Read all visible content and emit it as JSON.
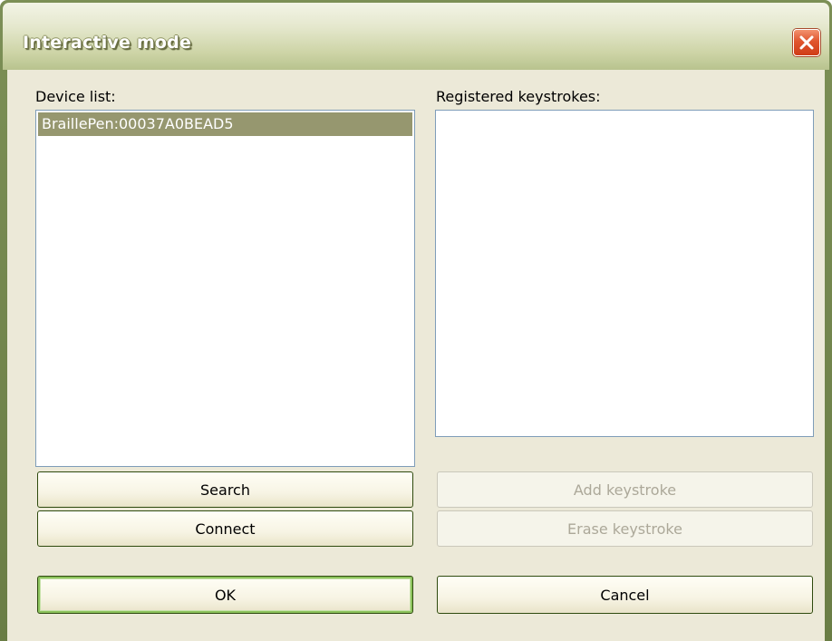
{
  "window": {
    "title": "Interactive mode",
    "close_icon": "close-icon"
  },
  "device_list": {
    "label": "Device list:",
    "items": [
      {
        "text": "BraillePen:00037A0BEAD5",
        "selected": true
      }
    ]
  },
  "keystrokes": {
    "label": "Registered keystrokes:",
    "items": []
  },
  "buttons": {
    "search": "Search",
    "connect": "Connect",
    "add_keystroke": "Add keystroke",
    "erase_keystroke": "Erase keystroke",
    "ok": "OK",
    "cancel": "Cancel"
  },
  "colors": {
    "title_bar": "#cdd4a6",
    "selection": "#96976f",
    "close_button": "#e0552e",
    "dialog_background": "#ece9d8"
  }
}
